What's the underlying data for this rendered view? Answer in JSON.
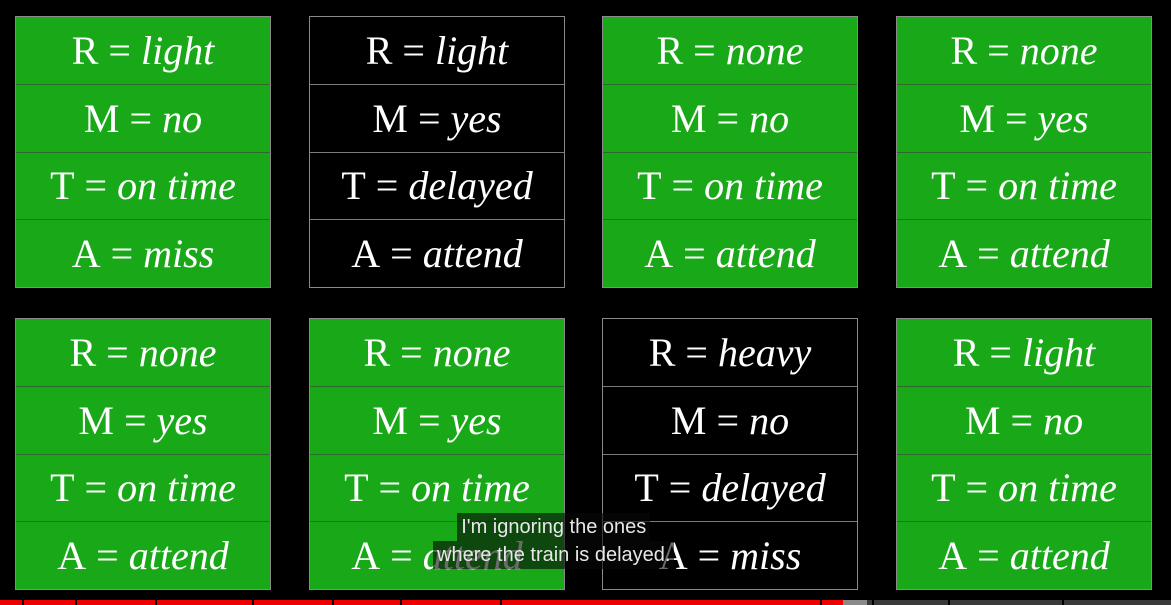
{
  "cards": [
    {
      "bg": "green",
      "rows": [
        [
          "R",
          "light"
        ],
        [
          "M",
          "no"
        ],
        [
          "T",
          "on time"
        ],
        [
          "A",
          "miss"
        ]
      ]
    },
    {
      "bg": "black",
      "rows": [
        [
          "R",
          "light"
        ],
        [
          "M",
          "yes"
        ],
        [
          "T",
          "delayed"
        ],
        [
          "A",
          "attend"
        ]
      ]
    },
    {
      "bg": "green",
      "rows": [
        [
          "R",
          "none"
        ],
        [
          "M",
          "no"
        ],
        [
          "T",
          "on time"
        ],
        [
          "A",
          "attend"
        ]
      ]
    },
    {
      "bg": "green",
      "rows": [
        [
          "R",
          "none"
        ],
        [
          "M",
          "yes"
        ],
        [
          "T",
          "on time"
        ],
        [
          "A",
          "attend"
        ]
      ]
    },
    {
      "bg": "green",
      "rows": [
        [
          "R",
          "none"
        ],
        [
          "M",
          "yes"
        ],
        [
          "T",
          "on time"
        ],
        [
          "A",
          "attend"
        ]
      ]
    },
    {
      "bg": "green",
      "rows": [
        [
          "R",
          "none"
        ],
        [
          "M",
          "yes"
        ],
        [
          "T",
          "on time"
        ],
        [
          "A",
          "attend"
        ]
      ]
    },
    {
      "bg": "black",
      "rows": [
        [
          "R",
          "heavy"
        ],
        [
          "M",
          "no"
        ],
        [
          "T",
          "delayed"
        ],
        [
          "A",
          "miss"
        ]
      ]
    },
    {
      "bg": "green",
      "rows": [
        [
          "R",
          "light"
        ],
        [
          "M",
          "no"
        ],
        [
          "T",
          "on time"
        ],
        [
          "A",
          "attend"
        ]
      ]
    }
  ],
  "equals_sign": "=",
  "colors": {
    "green": "#18a818",
    "black": "#000000",
    "progress_played": "#ee0000"
  },
  "caption": {
    "line1": "I'm ignoring the ones",
    "line2": "where the train is delayed."
  },
  "player": {
    "progress_fraction": 0.72
  }
}
